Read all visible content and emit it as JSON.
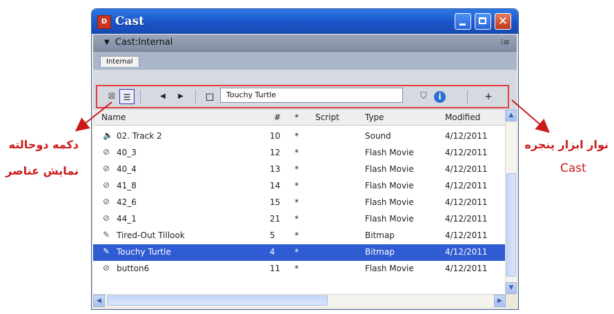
{
  "window": {
    "title": "Cast",
    "app_icon": "director-icon",
    "accent": "#1a55c9"
  },
  "castbar": {
    "label": "Cast:Internal",
    "options_icon": "⁝≡"
  },
  "tab": {
    "label": "Internal"
  },
  "toolbar": {
    "member_name": "Touchy Turtle",
    "new_cast_label": "+"
  },
  "columns": [
    "Name",
    "#",
    "*",
    "Script",
    "Type",
    "Modified"
  ],
  "rows": [
    {
      "icon": "🔈",
      "name": "02. Track 2",
      "num": "10",
      "star": "*",
      "script": "",
      "type": "Sound",
      "modified": "4/12/2011",
      "selected": false
    },
    {
      "icon": "⊘",
      "name": "40_3",
      "num": "12",
      "star": "*",
      "script": "",
      "type": "Flash Movie",
      "modified": "4/12/2011",
      "selected": false
    },
    {
      "icon": "⊘",
      "name": "40_4",
      "num": "13",
      "star": "*",
      "script": "",
      "type": "Flash Movie",
      "modified": "4/12/2011",
      "selected": false
    },
    {
      "icon": "⊘",
      "name": "41_8",
      "num": "14",
      "star": "*",
      "script": "",
      "type": "Flash Movie",
      "modified": "4/12/2011",
      "selected": false
    },
    {
      "icon": "⊘",
      "name": "42_6",
      "num": "15",
      "star": "*",
      "script": "",
      "type": "Flash Movie",
      "modified": "4/12/2011",
      "selected": false
    },
    {
      "icon": "⊘",
      "name": "44_1",
      "num": "21",
      "star": "*",
      "script": "",
      "type": "Flash Movie",
      "modified": "4/12/2011",
      "selected": false
    },
    {
      "icon": "✎",
      "name": "Tired-Out Tillook",
      "num": "5",
      "star": "*",
      "script": "",
      "type": "Bitmap",
      "modified": "4/12/2011",
      "selected": false
    },
    {
      "icon": "✎",
      "name": "Touchy Turtle",
      "num": "4",
      "star": "*",
      "script": "",
      "type": "Bitmap",
      "modified": "4/12/2011",
      "selected": true
    },
    {
      "icon": "⊘",
      "name": "button6",
      "num": "11",
      "star": "*",
      "script": "",
      "type": "Flash Movie",
      "modified": "4/12/2011",
      "selected": false
    }
  ],
  "annotations": {
    "left_line1": "دکمه دوحالته",
    "left_line2": "نمایش عناصر",
    "right_line1": "نوار ابزار پنجره",
    "right_line2": "Cast",
    "color": "#cc1a1a"
  }
}
